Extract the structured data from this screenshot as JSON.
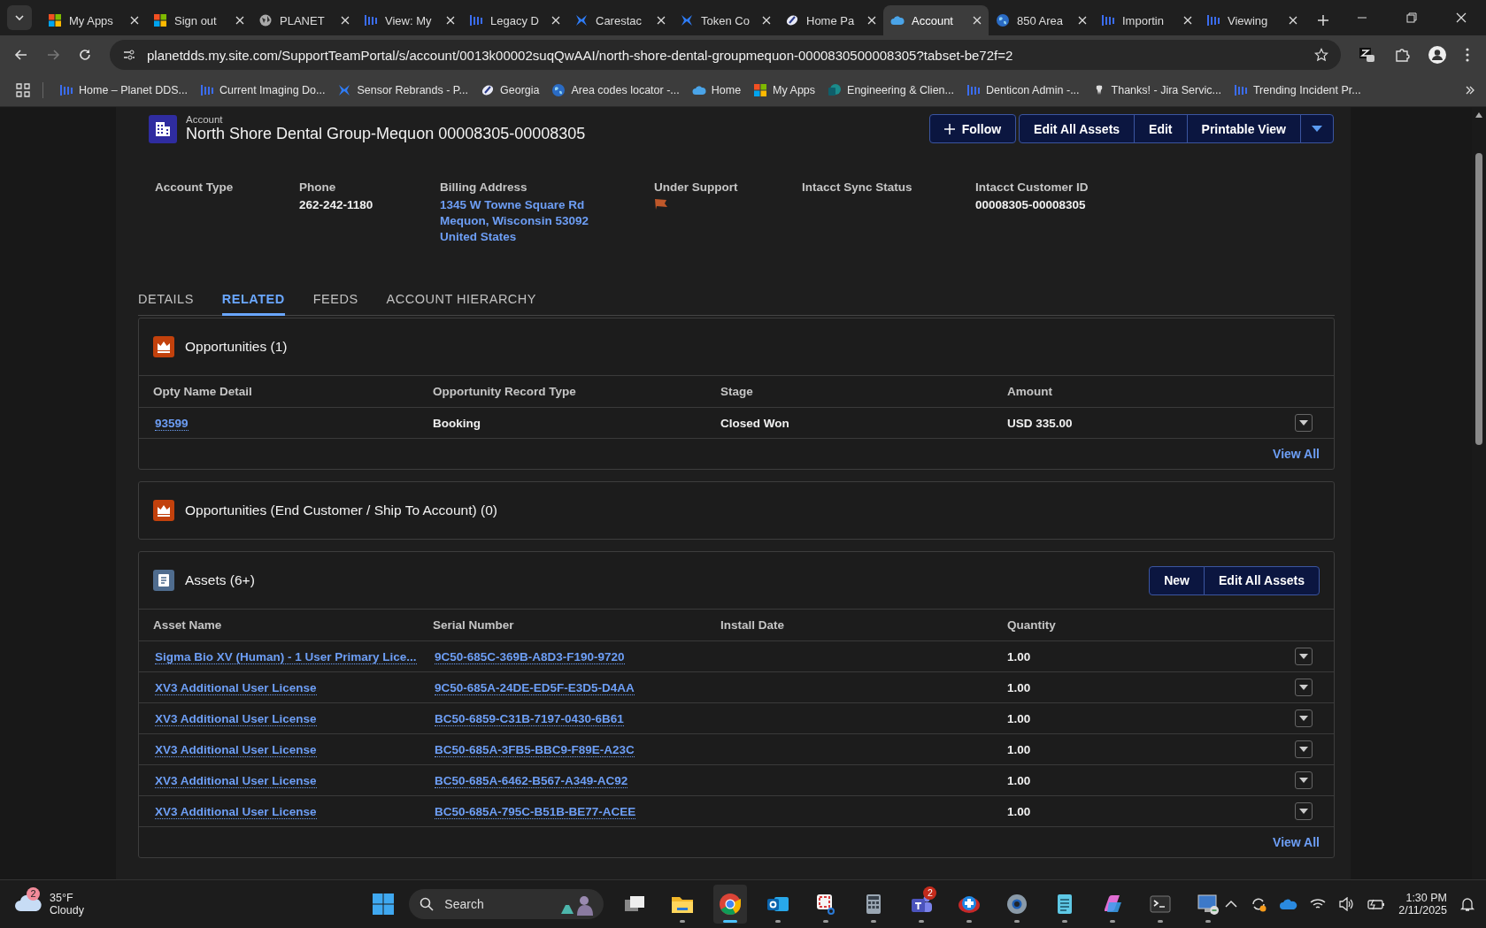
{
  "browser": {
    "tabs": [
      {
        "title": "My Apps",
        "kind": "grid",
        "selected": false
      },
      {
        "title": "Sign out",
        "kind": "grid",
        "selected": false
      },
      {
        "title": "PLANET",
        "kind": "globe",
        "selected": false
      },
      {
        "title": "View: My",
        "kind": "bars",
        "selected": false
      },
      {
        "title": "Legacy D",
        "kind": "bars",
        "selected": false
      },
      {
        "title": "Carestac",
        "kind": "cross",
        "selected": false
      },
      {
        "title": "Token Co",
        "kind": "cross",
        "selected": false
      },
      {
        "title": "Home Pa",
        "kind": "pen",
        "selected": false
      },
      {
        "title": "Account",
        "kind": "cloud",
        "selected": true
      },
      {
        "title": "850 Area",
        "kind": "earth",
        "selected": false
      },
      {
        "title": "Importin",
        "kind": "bars",
        "selected": false
      },
      {
        "title": "Viewing",
        "kind": "bars",
        "selected": false
      }
    ],
    "url": "planetdds.my.site.com/SupportTeamPortal/s/account/0013k00002suqQwAAI/north-shore-dental-groupmequon-0000830500008305?tabset-be72f=2",
    "bookmarks": [
      {
        "title": "Home – Planet DDS...",
        "kind": "bars"
      },
      {
        "title": "Current Imaging Do...",
        "kind": "bars"
      },
      {
        "title": "Sensor Rebrands - P...",
        "kind": "cross"
      },
      {
        "title": "Georgia",
        "kind": "pen"
      },
      {
        "title": "Area codes locator -...",
        "kind": "earth"
      },
      {
        "title": "Home",
        "kind": "cloud"
      },
      {
        "title": "My Apps",
        "kind": "grid"
      },
      {
        "title": "Engineering & Clien...",
        "kind": "sharepoint"
      },
      {
        "title": "Denticon Admin -...",
        "kind": "bars"
      },
      {
        "title": "Thanks! - Jira Servic...",
        "kind": "tooth"
      },
      {
        "title": "Trending Incident Pr...",
        "kind": "bars"
      }
    ]
  },
  "record": {
    "object": "Account",
    "name": "North Shore Dental Group-Mequon 00008305-00008305",
    "actions": [
      "Follow",
      "Edit All Assets",
      "Edit",
      "Printable View"
    ],
    "fields": [
      {
        "label": "Account Type",
        "kind": "text"
      },
      {
        "label": "Phone",
        "kind": "text",
        "lines": [
          "262-242-1180"
        ]
      },
      {
        "label": "Billing Address",
        "kind": "link",
        "lines": [
          "1345 W Towne Square Rd",
          "Mequon, Wisconsin 53092",
          "United States"
        ]
      },
      {
        "label": "Under Support",
        "kind": "flag"
      },
      {
        "label": "Intacct Sync Status",
        "kind": "text"
      },
      {
        "label": "Intacct Customer ID",
        "kind": "text",
        "lines": [
          "00008305-00008305"
        ]
      }
    ]
  },
  "tabs": [
    {
      "label": "DETAILS",
      "selected": false
    },
    {
      "label": "RELATED",
      "selected": true
    },
    {
      "label": "FEEDS",
      "selected": false
    },
    {
      "label": "ACCOUNT HIERARCHY",
      "selected": false
    }
  ],
  "related": [
    {
      "title": "Opportunities (1)",
      "kind": "crown",
      "columns": [
        {
          "label": "Opty Name Detail",
          "kind": "link"
        },
        {
          "label": "Opportunity Record Type",
          "kind": "text"
        },
        {
          "label": "Stage",
          "kind": "text"
        },
        {
          "label": "Amount",
          "kind": "text"
        }
      ],
      "rows": [
        [
          "93599",
          "Booking",
          "Closed Won",
          "USD 335.00"
        ]
      ],
      "footer": "View All"
    },
    {
      "title": "Opportunities (End Customer / Ship To Account) (0)",
      "kind": "crown"
    },
    {
      "title": "Assets (6+)",
      "kind": "asset",
      "buttons": [
        "New",
        "Edit All Assets"
      ],
      "columns": [
        {
          "label": "Asset Name",
          "kind": "link"
        },
        {
          "label": "Serial Number",
          "kind": "link"
        },
        {
          "label": "Install Date",
          "kind": "text"
        },
        {
          "label": "Quantity",
          "kind": "text"
        }
      ],
      "rows": [
        [
          "Sigma Bio XV (Human) - 1 User Primary Lice...",
          "9C50-685C-369B-A8D3-F190-9720",
          "",
          "1.00"
        ],
        [
          "XV3 Additional User License",
          "9C50-685A-24DE-ED5F-E3D5-D4AA",
          "",
          "1.00"
        ],
        [
          "XV3 Additional User License",
          "BC50-6859-C31B-7197-0430-6B61",
          "",
          "1.00"
        ],
        [
          "XV3 Additional User License",
          "BC50-685A-3FB5-BBC9-F89E-A23C",
          "",
          "1.00"
        ],
        [
          "XV3 Additional User License",
          "BC50-685A-6462-B567-A349-AC92",
          "",
          "1.00"
        ],
        [
          "XV3 Additional User License",
          "BC50-685A-795C-B51B-BE77-ACEE",
          "",
          "1.00"
        ]
      ],
      "footer": "View All"
    }
  ],
  "taskbar": {
    "weather": {
      "badge": "2",
      "temp": "35°F",
      "condition": "Cloudy"
    },
    "search": {
      "placeholder": "Search"
    },
    "apps": [
      {
        "kind": "taskview",
        "running": false,
        "selected": false
      },
      {
        "kind": "folder",
        "running": true,
        "selected": false
      },
      {
        "kind": "chrome",
        "running": true,
        "selected": true
      },
      {
        "kind": "mail",
        "running": true,
        "selected": false
      },
      {
        "kind": "snip",
        "running": true,
        "selected": false
      },
      {
        "kind": "calculator",
        "running": true,
        "selected": false
      },
      {
        "kind": "teams",
        "running": true,
        "selected": false,
        "badge": "2"
      },
      {
        "kind": "plus",
        "running": true,
        "selected": false
      },
      {
        "kind": "gear",
        "running": true,
        "selected": false
      },
      {
        "kind": "notepad",
        "running": true,
        "selected": false
      },
      {
        "kind": "copilot",
        "running": true,
        "selected": false
      },
      {
        "kind": "terminal",
        "running": true,
        "selected": false
      },
      {
        "kind": "remote",
        "running": true,
        "selected": false
      }
    ],
    "time": "1:30 PM",
    "date": "2/11/2025"
  }
}
